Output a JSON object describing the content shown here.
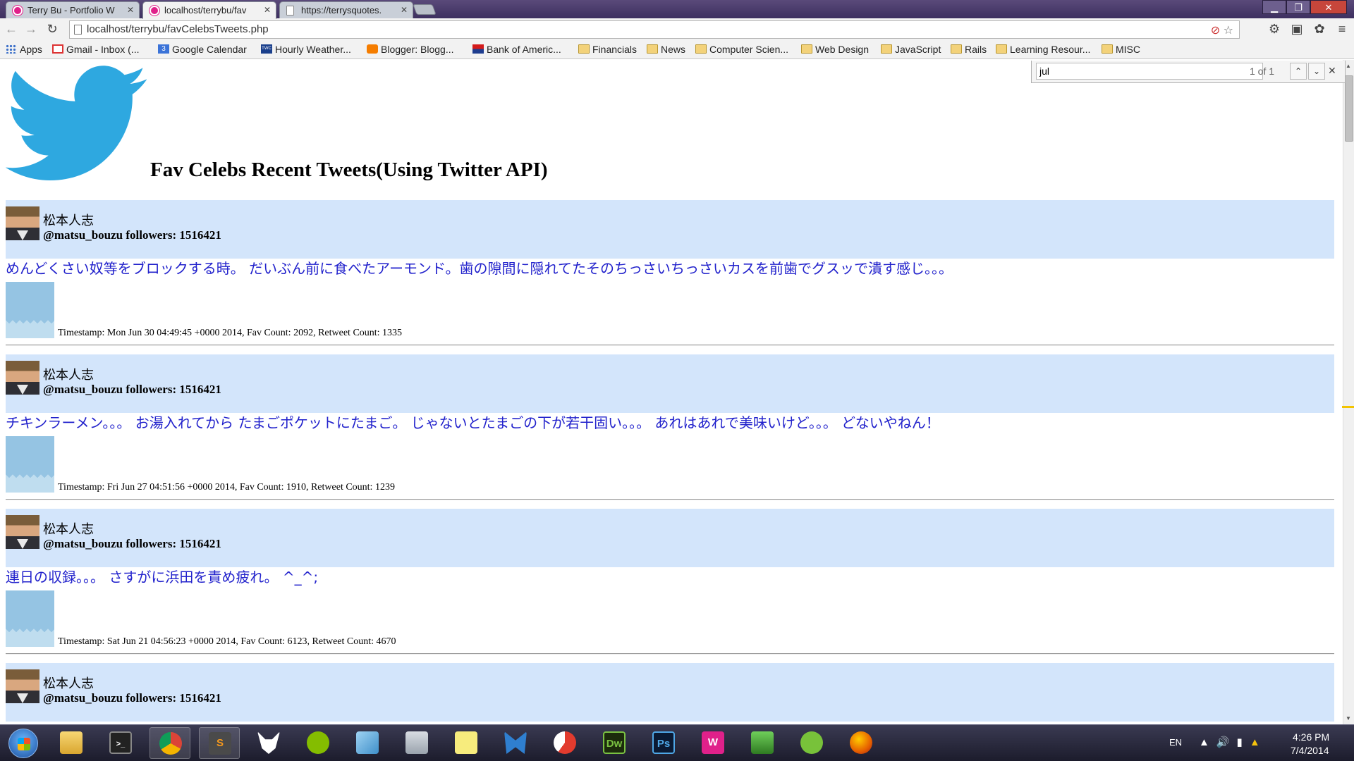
{
  "browser": {
    "tabs": [
      {
        "title": "Terry Bu - Portfolio W"
      },
      {
        "title": "localhost/terrybu/fav"
      },
      {
        "title": "https://terrysquotes."
      }
    ],
    "url": "localhost/terrybu/favCelebsTweets.php",
    "bookmarks": [
      {
        "label": "Apps",
        "icon": "apps-grid-icon"
      },
      {
        "label": "Gmail - Inbox (...",
        "icon": "gmail-icon"
      },
      {
        "label": "Google Calendar",
        "icon": "calendar-icon"
      },
      {
        "label": "Hourly Weather...",
        "icon": "weather-icon"
      },
      {
        "label": "Blogger: Blogg...",
        "icon": "blogger-icon"
      },
      {
        "label": "Bank of Americ...",
        "icon": "bank-icon"
      },
      {
        "label": "Financials",
        "icon": "folder-icon"
      },
      {
        "label": "News",
        "icon": "folder-icon"
      },
      {
        "label": "Computer Scien...",
        "icon": "folder-icon"
      },
      {
        "label": "Web Design",
        "icon": "folder-icon"
      },
      {
        "label": "JavaScript",
        "icon": "folder-icon"
      },
      {
        "label": "Rails",
        "icon": "folder-icon"
      },
      {
        "label": "Learning Resour...",
        "icon": "folder-icon"
      },
      {
        "label": "MISC",
        "icon": "folder-icon"
      }
    ],
    "find": {
      "query": "jul",
      "count": "1 of 1"
    }
  },
  "page": {
    "title": "Fav Celebs Recent Tweets(Using Twitter API)",
    "tweets": [
      {
        "name": "松本人志",
        "handle": "@matsu_bouzu followers: 1516421",
        "text": "めんどくさい奴等をブロックする時。 だいぶん前に食べたアーモンド。歯の隙間に隠れてたそのちっさいちっさいカスを前歯でグスッで潰す感じ。。。",
        "meta": "Timestamp: Mon Jun 30 04:49:45 +0000 2014, Fav Count: 2092, Retweet Count: 1335"
      },
      {
        "name": "松本人志",
        "handle": "@matsu_bouzu followers: 1516421",
        "text": "チキンラーメン。。。 お湯入れてから たまごポケットにたまご。 じゃないとたまごの下が若干固い。。。 あれはあれで美味いけど。。。 どないやねん！",
        "meta": "Timestamp: Fri Jun 27 04:51:56 +0000 2014, Fav Count: 1910, Retweet Count: 1239"
      },
      {
        "name": "松本人志",
        "handle": "@matsu_bouzu followers: 1516421",
        "text": "連日の収録。。。 さすがに浜田を責め疲れ。 ^_^;",
        "meta": "Timestamp: Sat Jun 21 04:56:23 +0000 2014, Fav Count: 6123, Retweet Count: 4670"
      },
      {
        "name": "松本人志",
        "handle": "@matsu_bouzu followers: 1516421",
        "text": "",
        "meta": ""
      }
    ]
  },
  "taskbar": {
    "apps": [
      {
        "icon": "explorer-icon"
      },
      {
        "icon": "terminal-icon"
      },
      {
        "icon": "chrome-icon"
      },
      {
        "icon": "sublime-icon",
        "label": "S"
      },
      {
        "icon": "fox-icon"
      },
      {
        "icon": "spotify-icon"
      },
      {
        "icon": "notepad-icon"
      },
      {
        "icon": "calculator-icon"
      },
      {
        "icon": "sticky-notes-icon"
      },
      {
        "icon": "malwarebytes-icon"
      },
      {
        "icon": "ccleaner-icon"
      },
      {
        "icon": "dreamweaver-icon",
        "label": "Dw"
      },
      {
        "icon": "photoshop-icon",
        "label": "Ps"
      },
      {
        "icon": "wamp-icon",
        "label": "W"
      },
      {
        "icon": "vpn-icon"
      },
      {
        "icon": "utorrent-icon"
      },
      {
        "icon": "firefox-icon"
      }
    ],
    "language": "EN",
    "time": "4:26 PM",
    "date": "7/4/2014"
  },
  "colors": {
    "tweet_header_bg": "#d3e5fb",
    "tweet_text": "#2222cc",
    "twitter_blue": "#2ea8e0"
  }
}
